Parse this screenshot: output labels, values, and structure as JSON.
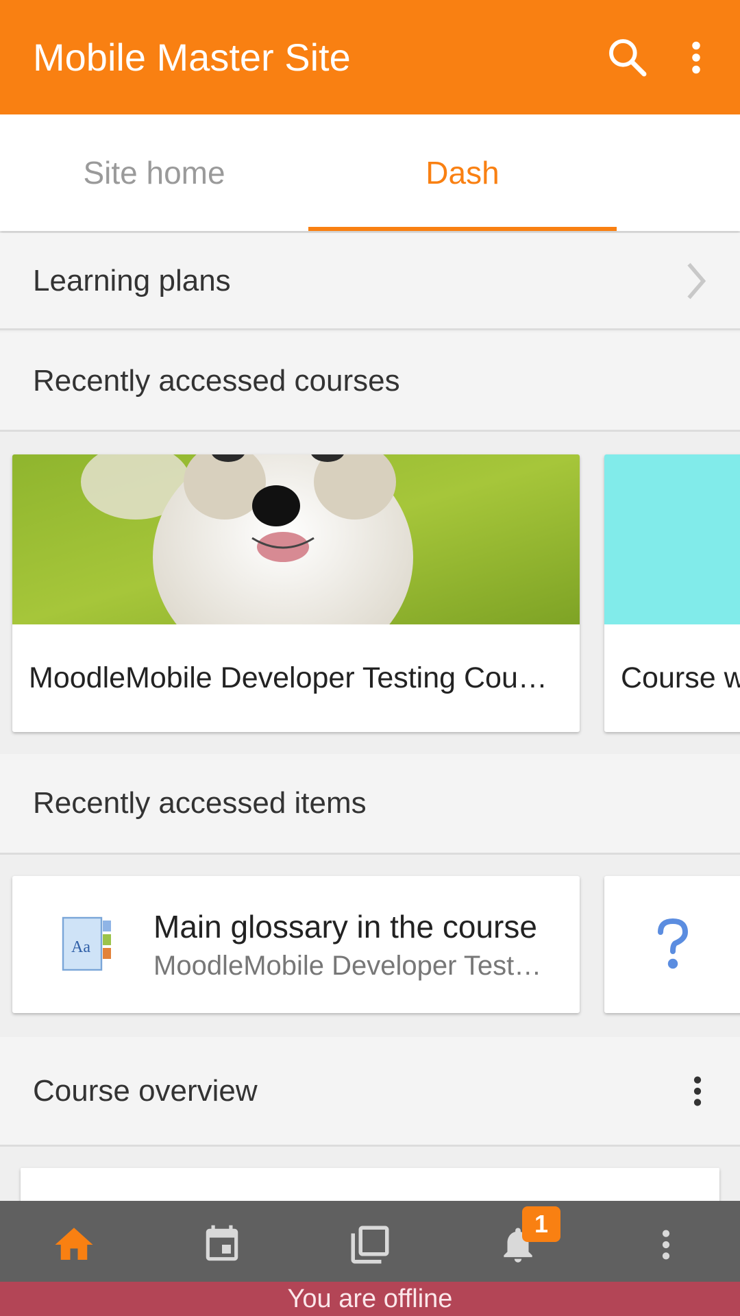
{
  "header": {
    "title": "Mobile Master Site",
    "search_icon": "search-icon",
    "menu_icon": "more-vertical-icon"
  },
  "tabs": [
    {
      "label": "Site home",
      "active": false
    },
    {
      "label": "Dash",
      "active": true
    }
  ],
  "learning_plans": {
    "label": "Learning plans"
  },
  "recent_courses": {
    "title": "Recently accessed courses",
    "courses": [
      {
        "name": "MoodleMobile Developer Testing Cou…",
        "image": "puppy-photo"
      },
      {
        "name": "Course w",
        "image_color": "#81ebea"
      }
    ]
  },
  "recent_items": {
    "title": "Recently accessed items",
    "items": [
      {
        "title": "Main glossary in the course",
        "subtitle": "MoodleMobile Developer Test…",
        "icon": "glossary-icon"
      },
      {
        "title": "",
        "subtitle": "",
        "icon": "question-icon"
      }
    ]
  },
  "course_overview": {
    "title": "Course overview"
  },
  "bottom_nav": {
    "items": [
      "home-icon",
      "calendar-icon",
      "messages-icon",
      "notifications-icon",
      "more-icon"
    ],
    "notification_badge": "1"
  },
  "status": {
    "offline_text": "You are offline"
  },
  "colors": {
    "accent": "#f98012",
    "offline_bar": "#b34556",
    "bottom_nav": "#606060"
  }
}
